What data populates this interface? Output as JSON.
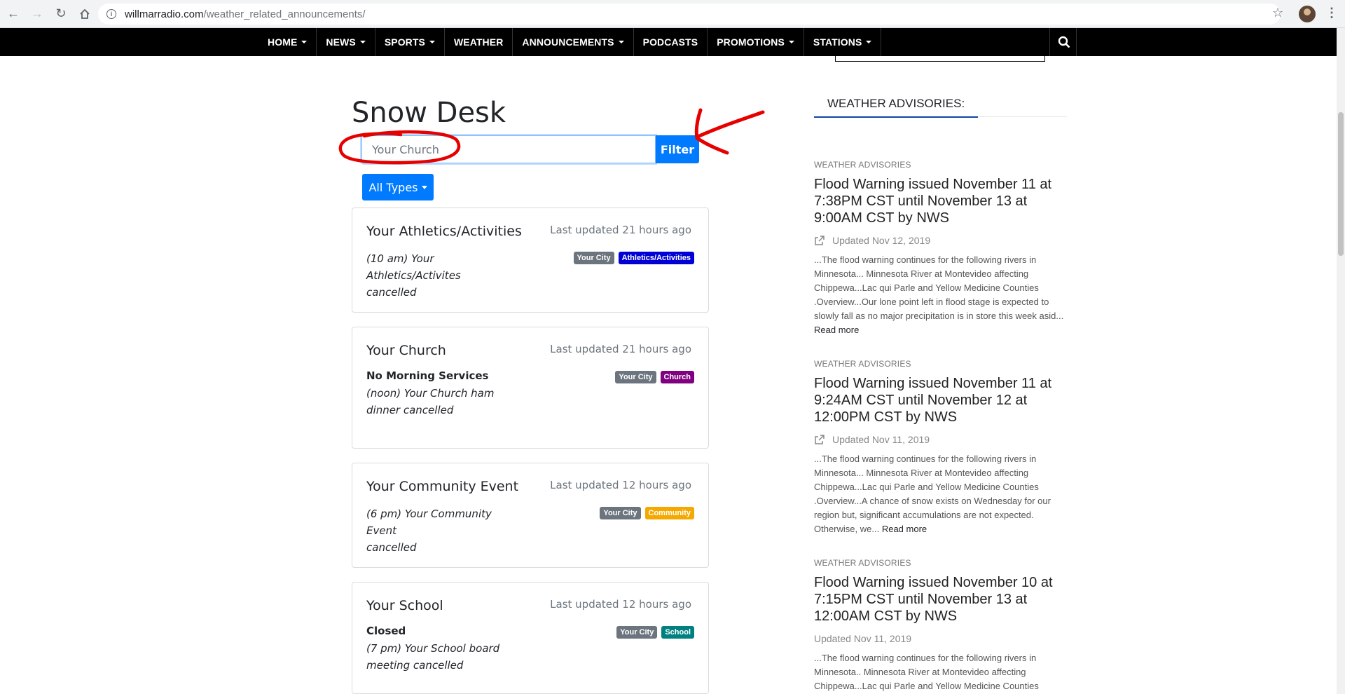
{
  "browser": {
    "url_host": "willmarradio.com",
    "url_path": "/weather_related_announcements/"
  },
  "nav": {
    "items": [
      {
        "label": "HOME",
        "dropdown": true
      },
      {
        "label": "NEWS",
        "dropdown": true
      },
      {
        "label": "SPORTS",
        "dropdown": true
      },
      {
        "label": "WEATHER",
        "dropdown": false
      },
      {
        "label": "ANNOUNCEMENTS",
        "dropdown": true
      },
      {
        "label": "PODCASTS",
        "dropdown": false
      },
      {
        "label": "PROMOTIONS",
        "dropdown": true
      },
      {
        "label": "STATIONS",
        "dropdown": true
      }
    ]
  },
  "main": {
    "title": "Snow Desk",
    "filter_value": "Your Church",
    "filter_button": "Filter",
    "types_button": "All Types",
    "cards": [
      {
        "title": "Your Athletics/Activities",
        "updated": "Last updated 21 hours ago",
        "headline": "",
        "desc_lines": [
          "(10 am) Your Athletics/Activites",
          "cancelled"
        ],
        "badges": [
          {
            "label": "Your City",
            "color": "#6c757d"
          },
          {
            "label": "Athletics/Activities",
            "color": "#0000d6"
          }
        ]
      },
      {
        "title": "Your Church",
        "updated": "Last updated 21 hours ago",
        "headline": "No Morning Services",
        "desc_lines": [
          "(noon) Your Church ham",
          "dinner cancelled"
        ],
        "badges": [
          {
            "label": "Your City",
            "color": "#6c757d"
          },
          {
            "label": "Church",
            "color": "#800080"
          }
        ]
      },
      {
        "title": "Your Community Event",
        "updated": "Last updated 12 hours ago",
        "headline": "",
        "desc_lines": [
          "(6 pm) Your Community Event",
          "cancelled"
        ],
        "badges": [
          {
            "label": "Your City",
            "color": "#6c757d"
          },
          {
            "label": "Community",
            "color": "#f5a800"
          }
        ]
      },
      {
        "title": "Your School",
        "updated": "Last updated 12 hours ago",
        "headline": "Closed",
        "desc_lines": [
          "(7 pm) Your School board",
          "meeting cancelled"
        ],
        "badges": [
          {
            "label": "Your City",
            "color": "#6c757d"
          },
          {
            "label": "School",
            "color": "#008080"
          }
        ]
      }
    ]
  },
  "sidebar": {
    "heading": "WEATHER ADVISORIES:",
    "advisories": [
      {
        "category": "WEATHER ADVISORIES",
        "title": "Flood Warning issued November 11 at 7:38PM CST until November 13 at 9:00AM CST by NWS",
        "updated": "Updated Nov 12, 2019",
        "excerpt": "...The flood warning continues for the following rivers in Minnesota... Minnesota River at Montevideo affecting Chippewa...Lac qui Parle and Yellow Medicine Counties .Overview...Our lone point left in flood stage is expected to slowly fall as no major precipitation is in store this week asid...",
        "read_more": "Read more"
      },
      {
        "category": "WEATHER ADVISORIES",
        "title": "Flood Warning issued November 11 at 9:24AM CST until November 12 at 12:00PM CST by NWS",
        "updated": "Updated Nov 11, 2019",
        "excerpt": "...The flood warning continues for the following rivers in Minnesota... Minnesota River at Montevideo affecting Chippewa...Lac qui Parle and Yellow Medicine Counties .Overview...A chance of snow exists on Wednesday for our region but, significant accumulations are not expected. Otherwise, we...",
        "read_more": "Read more"
      },
      {
        "category": "WEATHER ADVISORIES",
        "title": "Flood Warning issued November 10 at 7:15PM CST until November 13 at 12:00AM CST by NWS",
        "updated": "Updated Nov 11, 2019",
        "excerpt": "...The flood warning continues for the following rivers in Minnesota.. Minnesota River at Montevideo affecting Chippewa...Lac qui Parle and Yellow Medicine Counties",
        "read_more": ""
      }
    ]
  },
  "colors": {
    "accent": "#007bff",
    "nav_bg": "#000000",
    "annotation": "#e60000"
  }
}
